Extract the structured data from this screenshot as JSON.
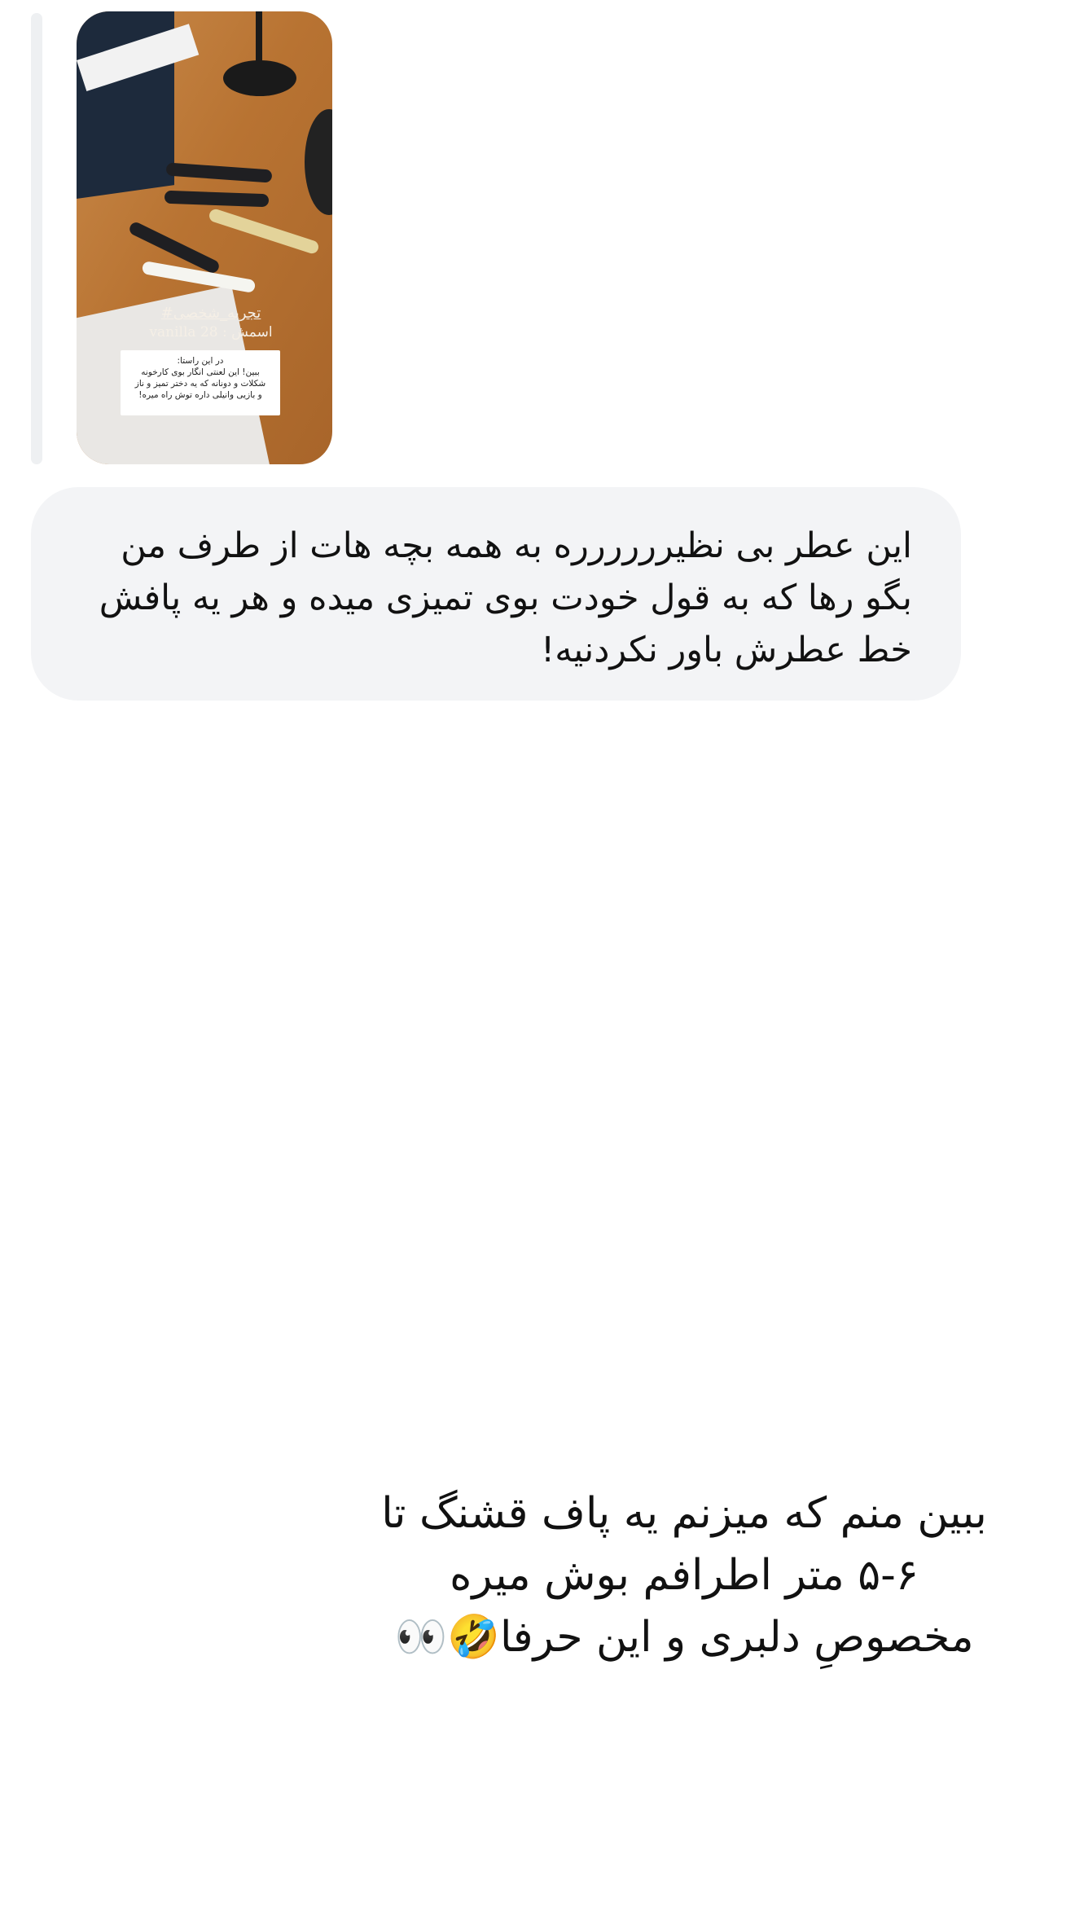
{
  "reply_preview": {
    "story_hashtag": "#تجربه_شخصی",
    "story_name": "vanilla 28 : اسمش",
    "story_note": [
      "در این راستا:",
      "ببین! این لعنتی انگار بوی کارخونه",
      "شکلات و دونانه که یه دختر تمیز و ناز",
      "و بازیی وانیلی داره توش راه میره!"
    ]
  },
  "message": {
    "text": "این عطر بی نظیرررررره به همه بچه هات از طرف من بگو رها که به قول خودت بوی تمیزی میده و هر یه پافش خط عطرش باور نکردنیه!"
  },
  "caption": {
    "line1": "ببین منم که میزنم یه پاف قشنگ تا",
    "line2": "۵-۶ متر اطرافم بوش میره",
    "line3": "مخصوصِ دلبری و این حرفا🤣👀"
  }
}
